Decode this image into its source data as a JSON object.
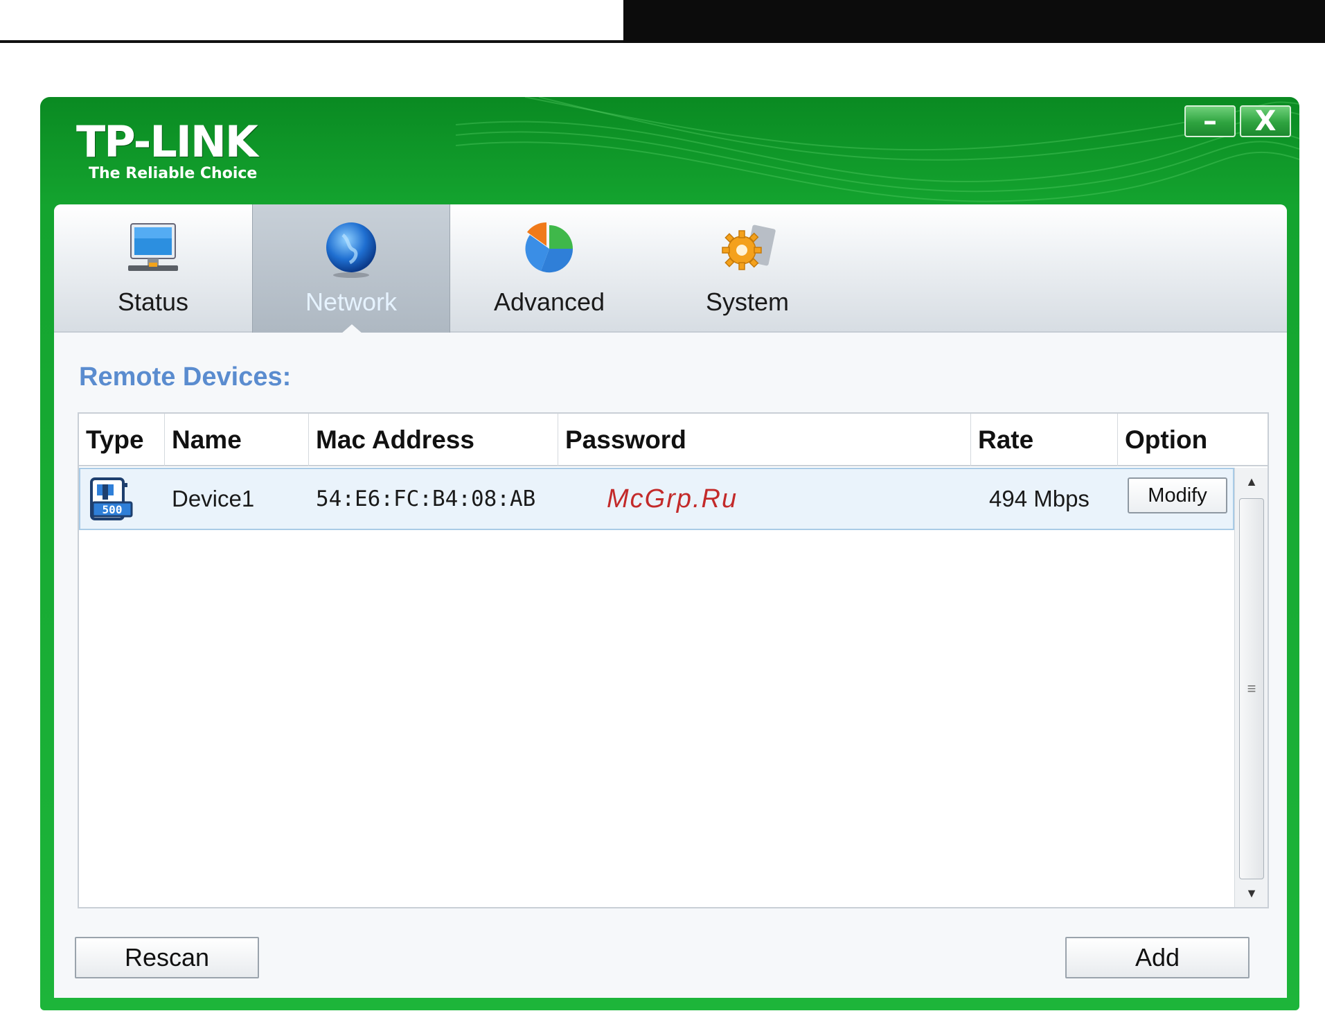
{
  "app": {
    "brand": "TP-LINK",
    "tagline": "The Reliable Choice",
    "minimize_label": "–",
    "close_label": "X"
  },
  "tabs": [
    {
      "label": "Status",
      "icon": "monitor-icon",
      "active": false
    },
    {
      "label": "Network",
      "icon": "globe-icon",
      "active": true
    },
    {
      "label": "Advanced",
      "icon": "pie-chart-icon",
      "active": false
    },
    {
      "label": "System",
      "icon": "gear-icon",
      "active": false
    }
  ],
  "section": {
    "title": "Remote Devices:"
  },
  "table": {
    "columns": [
      "Type",
      "Name",
      "Mac Address",
      "Password",
      "Rate",
      "Option"
    ],
    "rows": [
      {
        "type_icon": "powerline-adapter-icon",
        "name": "Device1",
        "mac": "54:E6:FC:B4:08:AB",
        "password": "",
        "rate": "494 Mbps",
        "option": "Modify"
      }
    ]
  },
  "watermark": "McGrp.Ru",
  "footer": {
    "rescan_label": "Rescan",
    "add_label": "Add"
  },
  "colors": {
    "brand_green": "#1db53a",
    "section_title": "#5a8ccf",
    "row_highlight": "#eaf3fb"
  }
}
